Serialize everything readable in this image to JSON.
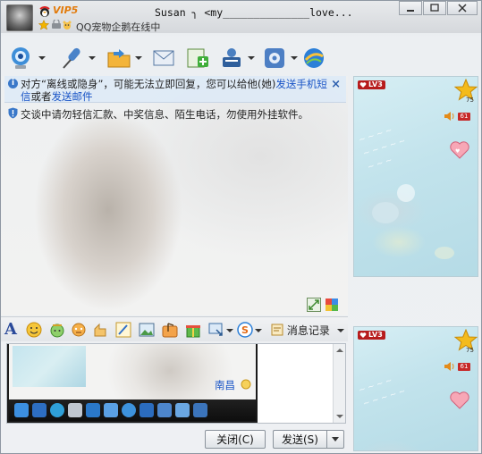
{
  "window": {
    "contact_name": "Susan  ╮ <my______________love...",
    "vip_label": "VIP5",
    "status": "QQ宠物企鹅在线中"
  },
  "notice": {
    "text_part1": "对方“离线或隐身”，可能无法立即回复，您可以给他(她)",
    "link1": "发送手机短信",
    "text_part2": "或者",
    "link2": "发送邮件",
    "warning": "交谈中请勿轻信汇款、中奖信息、陌生电话，勿使用外挂软件。"
  },
  "format_bar": {
    "message_record": "消息记录"
  },
  "input": {
    "signature_name": "南昌"
  },
  "buttons": {
    "close": "关闭(C)",
    "send": "发送(S)"
  },
  "side_panel": {
    "top": {
      "level": "LV3",
      "star_count": "75",
      "badge": "61"
    },
    "bottom": {
      "level": "LV3",
      "star_count": "75",
      "badge": "61"
    }
  }
}
